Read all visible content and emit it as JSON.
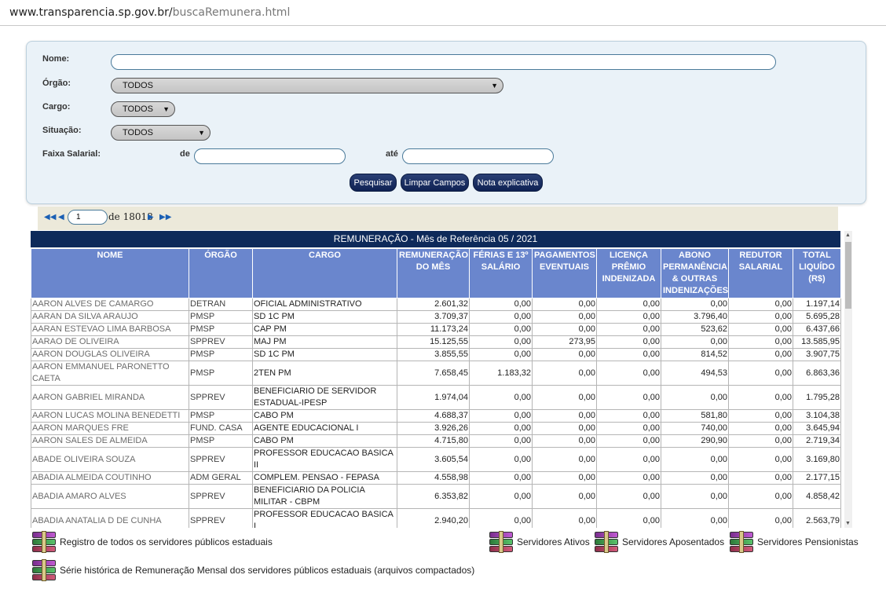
{
  "url": {
    "host": "www.transparencia.sp.gov.br/",
    "path": "buscaRemunera.html"
  },
  "form": {
    "nome_label": "Nome:",
    "orgao_label": "Órgão:",
    "orgao_value": "TODOS",
    "cargo_label": "Cargo:",
    "cargo_value": "TODOS",
    "situacao_label": "Situação:",
    "situacao_value": "TODOS",
    "faixa_label": "Faixa Salarial:",
    "de_label": "de",
    "ate_label": "até",
    "btn_pesquisar": "Pesquisar",
    "btn_limpar": "Limpar Campos",
    "btn_nota": "Nota explicativa"
  },
  "pager": {
    "page": "1",
    "of_text": "de 18018"
  },
  "table": {
    "caption": "REMUNERAÇÃO - Mês de Referência 05 / 2021",
    "headers": [
      "NOME",
      "ÓRGÃO",
      "CARGO",
      "REMUNERAÇÃO DO MÊS",
      "FÉRIAS E 13º SALÁRIO",
      "PAGAMENTOS EVENTUAIS",
      "LICENÇA PRÊMIO INDENIZADA",
      "ABONO PERMANÊNCIA & OUTRAS INDENIZAÇÕES",
      "REDUTOR SALARIAL",
      "TOTAL LIQUÍDO (R$)"
    ],
    "rows": [
      [
        "AARON ALVES DE CAMARGO",
        "DETRAN",
        "OFICIAL ADMINISTRATIVO",
        "2.601,32",
        "0,00",
        "0,00",
        "0,00",
        "0,00",
        "0,00",
        "1.197,14"
      ],
      [
        "AARAN DA SILVA ARAUJO",
        "PMSP",
        "SD 1C PM",
        "3.709,37",
        "0,00",
        "0,00",
        "0,00",
        "3.796,40",
        "0,00",
        "5.695,28"
      ],
      [
        "AARAN ESTEVAO LIMA BARBOSA",
        "PMSP",
        "CAP PM",
        "11.173,24",
        "0,00",
        "0,00",
        "0,00",
        "523,62",
        "0,00",
        "6.437,66"
      ],
      [
        "AARAO DE OLIVEIRA",
        "SPPREV",
        "MAJ PM",
        "15.125,55",
        "0,00",
        "273,95",
        "0,00",
        "0,00",
        "0,00",
        "13.585,95"
      ],
      [
        "AARON DOUGLAS OLIVEIRA",
        "PMSP",
        "SD 1C PM",
        "3.855,55",
        "0,00",
        "0,00",
        "0,00",
        "814,52",
        "0,00",
        "3.907,75"
      ],
      [
        "AARON EMMANUEL PARONETTO CAETA",
        "PMSP",
        "2TEN PM",
        "7.658,45",
        "1.183,32",
        "0,00",
        "0,00",
        "494,53",
        "0,00",
        "6.863,36"
      ],
      [
        "AARON GABRIEL MIRANDA",
        "SPPREV",
        "BENEFICIARIO DE SERVIDOR ESTADUAL-IPESP",
        "1.974,04",
        "0,00",
        "0,00",
        "0,00",
        "0,00",
        "0,00",
        "1.795,28"
      ],
      [
        "AARON LUCAS MOLINA BENEDETTI",
        "PMSP",
        "CABO PM",
        "4.688,37",
        "0,00",
        "0,00",
        "0,00",
        "581,80",
        "0,00",
        "3.104,38"
      ],
      [
        "AARON MARQUES FRE",
        "FUND. CASA",
        "AGENTE EDUCACIONAL I",
        "3.926,26",
        "0,00",
        "0,00",
        "0,00",
        "740,00",
        "0,00",
        "3.645,94"
      ],
      [
        "AARON SALES DE ALMEIDA",
        "PMSP",
        "CABO PM",
        "4.715,80",
        "0,00",
        "0,00",
        "0,00",
        "290,90",
        "0,00",
        "2.719,34"
      ],
      [
        "ABADE OLIVEIRA SOUZA",
        "SPPREV",
        "PROFESSOR EDUCACAO BASICA II",
        "3.605,54",
        "0,00",
        "0,00",
        "0,00",
        "0,00",
        "0,00",
        "3.169,80"
      ],
      [
        "ABADIA ALMEIDA COUTINHO",
        "ADM GERAL",
        "COMPLEM. PENSAO - FEPASA",
        "4.558,98",
        "0,00",
        "0,00",
        "0,00",
        "0,00",
        "0,00",
        "2.177,15"
      ],
      [
        "ABADIA AMARO ALVES",
        "SPPREV",
        "BENEFICIARIO DA POLICIA MILITAR - CBPM",
        "6.353,82",
        "0,00",
        "0,00",
        "0,00",
        "0,00",
        "0,00",
        "4.858,42"
      ],
      [
        "ABADIA ANATALIA D DE CUNHA",
        "SPPREV",
        "PROFESSOR EDUCACAO BASICA I",
        "2.940,20",
        "0,00",
        "0,00",
        "0,00",
        "0,00",
        "0,00",
        "2.563,79"
      ]
    ]
  },
  "downloads": {
    "todos": "Registro de todos os servidores públicos estaduais",
    "ativos": "Servidores Ativos",
    "aposentados": "Servidores Aposentados",
    "pensionistas": "Servidores Pensionistas",
    "serie": "Série histórica de Remuneração Mensal dos servidores públicos estaduais (arquivos compactados)"
  },
  "icons": {
    "archive": "winrar-archive-icon",
    "first": "first-page-icon",
    "prev": "prev-page-icon",
    "next": "next-page-icon",
    "last": "last-page-icon"
  },
  "colors": {
    "header_bg": "#6a86cd",
    "caption_bg": "#0e2a5a",
    "button_bg": "#0f2253",
    "panel_bg": "#eaf2f8"
  }
}
